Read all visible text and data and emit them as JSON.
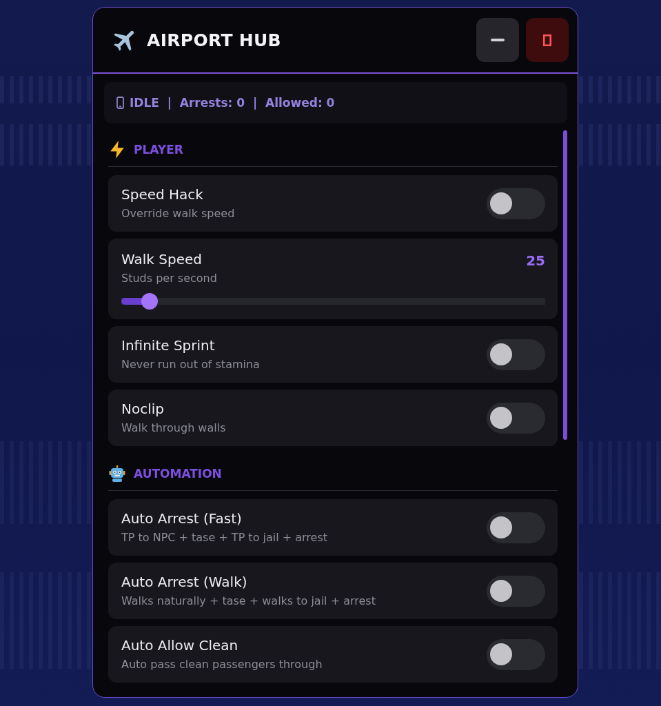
{
  "window": {
    "title": "AIRPORT HUB"
  },
  "status_bar": {
    "text": "IDLE  |  Arrests: 0  |  Allowed: 0"
  },
  "sections": [
    {
      "title": "PLAYER",
      "items": [
        {
          "kind": "toggle",
          "label": "Speed Hack",
          "description": "Override walk speed",
          "on": false
        },
        {
          "kind": "slider",
          "label": "Walk Speed",
          "description": "Studs per second",
          "reading": "25",
          "level": 0.066
        },
        {
          "kind": "toggle",
          "label": "Infinite Sprint",
          "description": "Never run out of stamina",
          "on": false
        },
        {
          "kind": "toggle",
          "label": "Noclip",
          "description": "Walk through walls",
          "on": false
        }
      ]
    },
    {
      "title": "AUTOMATION",
      "items": [
        {
          "kind": "toggle",
          "label": "Auto Arrest (Fast)",
          "description": "TP to NPC + tase + TP to jail + arrest",
          "on": false
        },
        {
          "kind": "toggle",
          "label": "Auto Arrest (Walk)",
          "description": "Walks naturally + tase + walks to jail + arrest",
          "on": false
        },
        {
          "kind": "toggle",
          "label": "Auto Allow Clean",
          "description": "Auto pass clean passengers through",
          "on": false
        }
      ]
    }
  ]
}
